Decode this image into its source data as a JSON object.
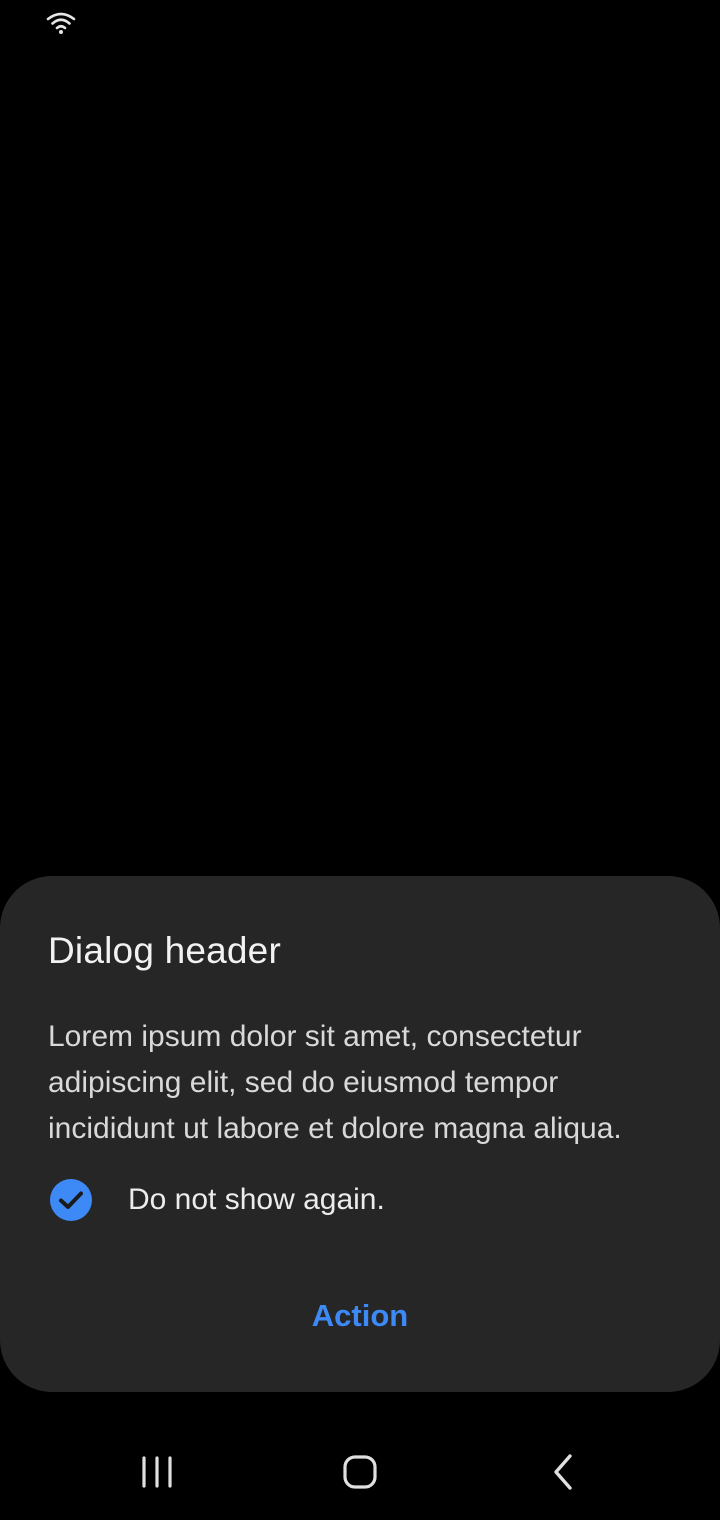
{
  "status_bar": {
    "icons": [
      "wifi-icon"
    ]
  },
  "dialog": {
    "title": "Dialog header",
    "body": "Lorem ipsum dolor sit amet, consectetur adipiscing elit, sed do eiusmod tempor incididunt ut labore et dolore magna aliqua.",
    "checkbox": {
      "label": "Do not show again.",
      "checked": true
    },
    "action_label": "Action"
  },
  "nav_bar": {
    "buttons": [
      "recent-apps-icon",
      "home-icon",
      "back-icon"
    ]
  },
  "colors": {
    "background": "#000000",
    "dialog_background": "#262626",
    "accent": "#3d8af7",
    "text_primary": "#f2f2f2"
  }
}
